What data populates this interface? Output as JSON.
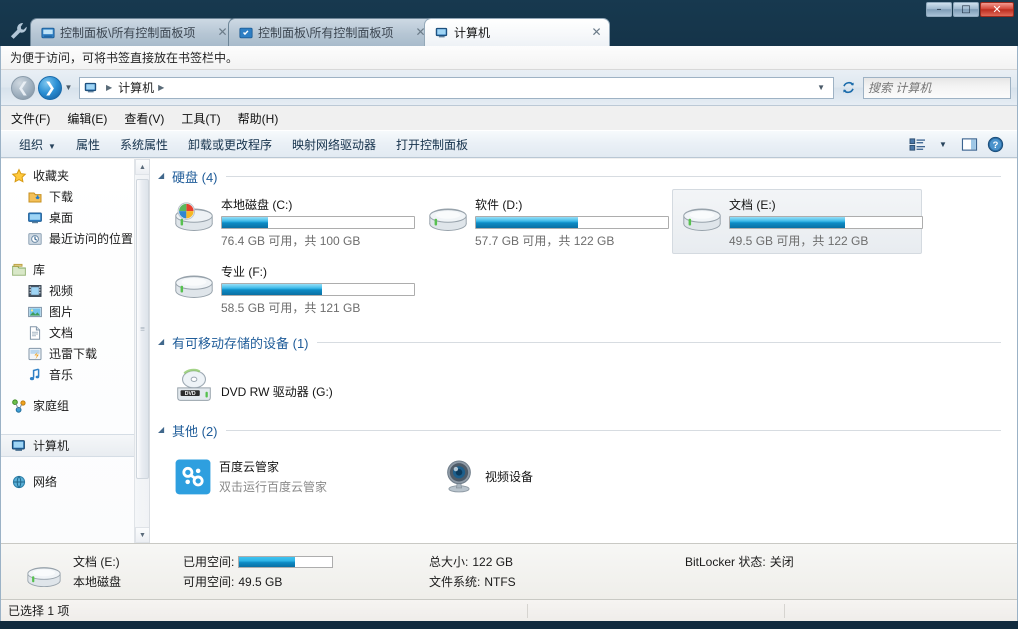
{
  "window": {
    "buttons": [
      {
        "name": "minimize",
        "glyph": "–"
      },
      {
        "name": "maximize",
        "glyph": "□"
      },
      {
        "name": "close",
        "glyph": "✕"
      }
    ]
  },
  "tabs": [
    {
      "title": "控制面板\\所有控制面板项",
      "icon": "control-panel-icon",
      "active": false,
      "close": "✕"
    },
    {
      "title": "控制面板\\所有控制面板项",
      "icon": "control-panel-icon",
      "active": false,
      "close": "✕"
    },
    {
      "title": "计算机",
      "icon": "computer-icon",
      "active": true,
      "close": "✕"
    }
  ],
  "hint_bar": {
    "text": "为便于访问，可将书签直接放在书签栏中。"
  },
  "address_bar": {
    "crumbs": [
      "计算机"
    ],
    "separator": "▶",
    "dropdown": "▼"
  },
  "search": {
    "placeholder": "搜索 计算机",
    "value": ""
  },
  "menu": {
    "items": [
      {
        "label": "文件(F)"
      },
      {
        "label": "编辑(E)"
      },
      {
        "label": "查看(V)"
      },
      {
        "label": "工具(T)"
      },
      {
        "label": "帮助(H)"
      }
    ]
  },
  "command_bar": {
    "items": [
      {
        "label": "组织",
        "caret": "▼"
      },
      {
        "label": "属性",
        "caret": ""
      },
      {
        "label": "系统属性",
        "caret": ""
      },
      {
        "label": "卸载或更改程序",
        "caret": ""
      },
      {
        "label": "映射网络驱动器",
        "caret": ""
      },
      {
        "label": "打开控制面板",
        "caret": ""
      }
    ],
    "right_icons": [
      {
        "name": "view-mode-icon"
      },
      {
        "name": "chevron-down-icon",
        "glyph": "▼"
      },
      {
        "name": "preview-pane-icon"
      },
      {
        "name": "help-icon",
        "glyph": "?"
      }
    ]
  },
  "sidebar": {
    "groups": [
      {
        "root": {
          "label": "收藏夹",
          "icon": "star-icon"
        },
        "children": [
          {
            "label": "下载",
            "icon": "downloads-icon"
          },
          {
            "label": "桌面",
            "icon": "desktop-icon"
          },
          {
            "label": "最近访问的位置",
            "icon": "recent-places-icon"
          }
        ]
      },
      {
        "root": {
          "label": "库",
          "icon": "library-icon"
        },
        "children": [
          {
            "label": "视频",
            "icon": "videos-icon"
          },
          {
            "label": "图片",
            "icon": "pictures-icon"
          },
          {
            "label": "文档",
            "icon": "documents-icon"
          },
          {
            "label": "迅雷下载",
            "icon": "thunder-download-icon"
          },
          {
            "label": "音乐",
            "icon": "music-icon"
          }
        ]
      },
      {
        "root": {
          "label": "家庭组",
          "icon": "homegroup-icon"
        },
        "children": []
      },
      {
        "root": {
          "label": "计算机",
          "icon": "computer-icon",
          "selected": true
        },
        "children": []
      },
      {
        "root": {
          "label": "网络",
          "icon": "network-icon",
          "clipped": true
        },
        "children": []
      }
    ],
    "scrollbar": {
      "up": "▲",
      "down": "▼"
    }
  },
  "content": {
    "groups": [
      {
        "name": "hard-disks",
        "triangle": "◢",
        "title": "硬盘 (4)",
        "rows": [
          [
            {
              "name": "本地磁盘 (C:)",
              "sub": "76.4 GB 可用，共 100 GB",
              "used_percent": 24,
              "icon": "system-drive-icon",
              "selected": false,
              "bar": true
            },
            {
              "name": "软件 (D:)",
              "sub": "57.7 GB 可用，共 122 GB",
              "used_percent": 53,
              "icon": "drive-icon",
              "selected": false,
              "bar": true
            },
            {
              "name": "文档 (E:)",
              "sub": "49.5 GB 可用，共 122 GB",
              "used_percent": 60,
              "icon": "drive-icon",
              "selected": true,
              "bar": true
            }
          ],
          [
            {
              "name": "专业 (F:)",
              "sub": "58.5 GB 可用，共 121 GB",
              "used_percent": 52,
              "icon": "drive-icon",
              "selected": false,
              "bar": true
            }
          ]
        ]
      },
      {
        "name": "removable-storage",
        "triangle": "◢",
        "title": "有可移动存储的设备 (1)",
        "rows": [
          [
            {
              "name": "DVD RW 驱动器 (G:)",
              "sub": "",
              "icon": "dvd-drive-icon",
              "selected": false,
              "bar": false
            }
          ]
        ]
      },
      {
        "name": "other",
        "triangle": "◢",
        "title": "其他 (2)",
        "rows": [
          [
            {
              "name": "百度云管家",
              "sub": "双击运行百度云管家",
              "icon": "baidu-cloud-icon",
              "selected": false,
              "bar": false
            },
            {
              "name": "视频设备",
              "sub": "",
              "icon": "webcam-icon",
              "selected": false,
              "bar": false
            }
          ]
        ]
      }
    ]
  },
  "details_pane": {
    "icon": "drive-icon",
    "line1_name": "文档 (E:)",
    "line2_name": "本地磁盘",
    "used_label": "已用空间:",
    "used_percent": 60,
    "free_label": "可用空间:",
    "free_value": "49.5 GB",
    "total_label": "总大小:",
    "total_value": "122 GB",
    "fs_label": "文件系统:",
    "fs_value": "NTFS",
    "bitlocker_label": "BitLocker 状态:",
    "bitlocker_value": "关闭"
  },
  "status_bar": {
    "text": "已选择 1 项"
  },
  "colors": {
    "group_title": "#1f5c99",
    "bar_fill_light": "#3fc3ef",
    "bar_fill_dark": "#0a6fa3",
    "accent": "#1a6bab"
  }
}
